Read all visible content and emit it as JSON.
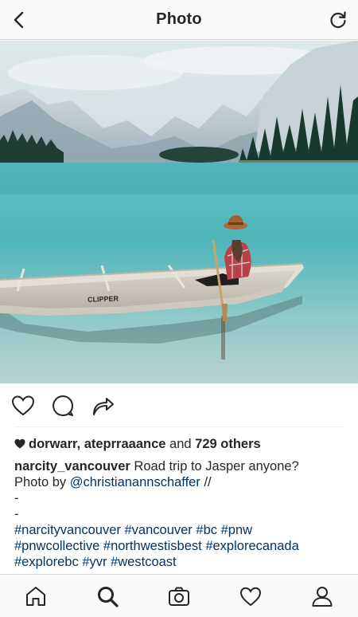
{
  "header": {
    "title": "Photo"
  },
  "post": {
    "liked_by": [
      "dorwarr",
      "ateprraaance"
    ],
    "likes_connector": "and",
    "others": "729 others",
    "caption": {
      "username": "narcity_vancouver",
      "text": "Road trip to Jasper anyone?",
      "line2_prefix": "Photo by",
      "mention": "@christianannschaffer",
      "line2_suffix": "//",
      "dash1": "-",
      "dash2": "-",
      "hashtags_line1": [
        "#narcityvancouver",
        "#vancouver",
        "#bc",
        "#pnw"
      ],
      "hashtags_line2": [
        "#pnwcollective",
        "#northwestisbest",
        "#explorecanada"
      ],
      "hashtags_line3": [
        "#explorebc",
        "#yvr",
        "#westcoast"
      ]
    }
  },
  "colors": {
    "link": "#003569",
    "text": "#262626",
    "bar_bg": "#fafafa",
    "border": "#dbdbdb"
  },
  "icons": {
    "header": [
      "back-chevron-icon",
      "refresh-icon"
    ],
    "actions": [
      "heart-icon",
      "comment-icon",
      "share-icon"
    ],
    "nav": [
      "home-icon",
      "search-icon",
      "camera-icon",
      "activity-heart-icon",
      "profile-icon"
    ]
  }
}
